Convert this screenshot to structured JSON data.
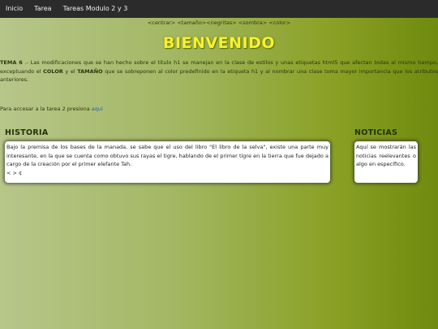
{
  "nav": {
    "items": [
      "Inicio",
      "Tarea",
      "Tareas Modulo 2 y 3"
    ]
  },
  "tagline": "<centrar> <tamaño><negritas> <sombra> <color>",
  "title": "BIENVENIDO",
  "tema": {
    "label": "TEMA 6",
    "text1": " .- Las modificaciones que se han hecho sobre el titulo h1 se manejan en la clase de estilos y unas etiquetas html5 que afectan todas al mismo tiempo, exceptuando el ",
    "color_word": "COLOR",
    "text2": " y el ",
    "size_word": "TAMAÑO",
    "text3": " que se sobreponen al color predefinido en la etiqueta h1 y al nombrar una clase toma mayor importancia que los atributos anteriores."
  },
  "acceso": {
    "text": "Para accesar a la tarea 2 presiona ",
    "link": "aqui"
  },
  "historia": {
    "heading": "HISTORIA",
    "body": "Bajo la premisa de los bases de la manada, se sabe que el uso del libro \"El libro de la selva\", existe una parte muy interesante, en la que se cuenta como obtuvo sus rayas el tigre, hablando de el primer tigre en la tierra que fue dejado a cargo de la creación por el primer elefante Tah.",
    "code": "< > ¢"
  },
  "noticias": {
    "heading": "NOTICIAS",
    "body": "Aquí se mostrarán las noticias reelevantes o algo en específico."
  },
  "colors": {
    "navbar": "#2b2b2b",
    "title": "#f6f233",
    "link": "#1f5fbf"
  }
}
